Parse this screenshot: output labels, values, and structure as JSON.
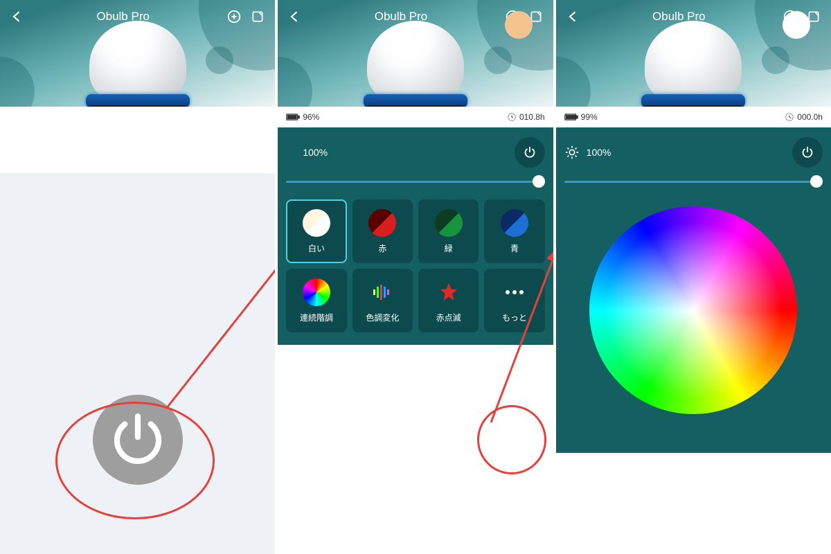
{
  "screens": [
    {
      "title": "Obulb Pro",
      "indicator_color": null,
      "battery": null,
      "runtime": null,
      "brightness": null,
      "modes": null
    },
    {
      "title": "Obulb Pro",
      "indicator_color": "#f5c48e",
      "battery": "96%",
      "runtime": "010.8h",
      "brightness": "100%",
      "modes": [
        {
          "label": "白い",
          "active": true,
          "type": "white"
        },
        {
          "label": "赤",
          "active": false,
          "type": "red"
        },
        {
          "label": "緑",
          "active": false,
          "type": "green"
        },
        {
          "label": "青",
          "active": false,
          "type": "blue"
        },
        {
          "label": "連続階調",
          "active": false,
          "type": "rainbow"
        },
        {
          "label": "色調変化",
          "active": false,
          "type": "eq"
        },
        {
          "label": "赤点滅",
          "active": false,
          "type": "redstar"
        },
        {
          "label": "もっと",
          "active": false,
          "type": "more"
        }
      ]
    },
    {
      "title": "Obulb Pro",
      "indicator_color": "#ffffff",
      "battery": "99%",
      "runtime": "000.0h",
      "brightness": "100%",
      "modes": null
    }
  ]
}
